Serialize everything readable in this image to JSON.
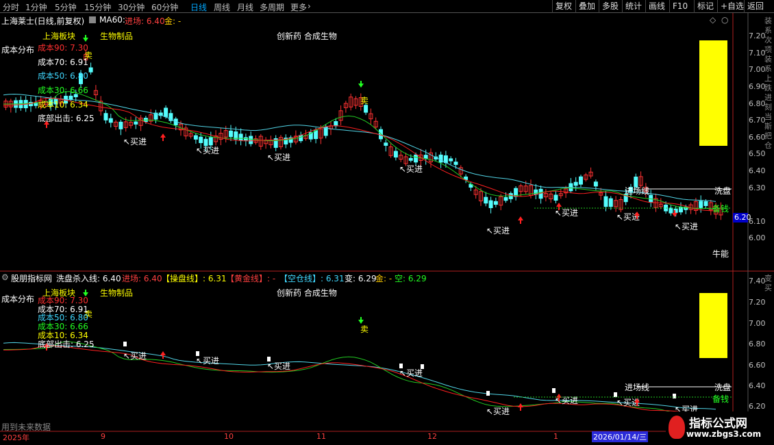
{
  "toolbar": {
    "periods": [
      "分时",
      "1分钟",
      "5分钟",
      "15分钟",
      "30分钟",
      "60分钟",
      "日线",
      "周线",
      "月线",
      "多周期",
      "更多"
    ],
    "more_arrow": "›",
    "buttons": [
      "复权",
      "叠加",
      "多股",
      "统计",
      "画线",
      "F10",
      "标记",
      "+自选",
      "返回"
    ]
  },
  "top_panel": {
    "title": "上海莱士(日线,前复权)",
    "ma_label": "MA60:",
    "jinchang_label": "进场: 6.40",
    "jin_label": "金: -",
    "cost_dist": "成本分布",
    "sector": "上海板块",
    "industry": "生物制品",
    "concepts": "创新药 合成生物",
    "cost90": "成本90: 7.30",
    "cost70": "成本70: 6.91",
    "cost50": "成本50: 6.80",
    "cost30": "成本30: 6.66",
    "cost10": "成本10: 6.34",
    "bottom_out": "底部出击: 6.25",
    "y_ticks": [
      "7.20",
      "7.10",
      "7.00",
      "6.90",
      "6.80",
      "6.70",
      "6.60",
      "6.50",
      "6.40",
      "6.30",
      "6.20",
      "6.10",
      "6.00"
    ],
    "price_tag": "6.20",
    "xipan_label": "洗盘",
    "jinchangxian_label": "进场线",
    "beiqian_label": "备钱",
    "niuneng_label": "牛能",
    "right_strip": "装系次项装系上跌进刻当斯把仓",
    "right_strip_small": "上跌\n刻当\n把仓"
  },
  "bottom_panel": {
    "title": "股朋指标网",
    "line1": "洗盘杀入线: 6.40",
    "line2": "进场: 6.40",
    "line3": "【操盘线】: 6.31",
    "line4": "【黄金线】: -",
    "line5": "【空仓线】: 6.31",
    "line6": "变: 6.29",
    "line7": "金: -",
    "line8": "空: 6.29",
    "cost_dist": "成本分布",
    "sector": "上海板块",
    "industry": "生物制品",
    "concepts": "创新药 合成生物",
    "cost90": "成本90: 7.30",
    "cost70": "成本70: 6.91",
    "cost50": "成本50: 6.80",
    "cost30": "成本30: 6.66",
    "cost10": "成本10: 6.34",
    "bottom_out": "底部出击: 6.25",
    "y_ticks": [
      "7.40",
      "7.20",
      "7.00",
      "6.80",
      "6.60",
      "6.40",
      "6.20"
    ],
    "xipan_label": "洗盘",
    "jinchangxian_label": "进场线",
    "beiqian_label": "备钱",
    "future_note": "用到未来数据",
    "right_strip": "变买"
  },
  "signals": {
    "sell": "卖",
    "buy": "买进",
    "buy_arrow": "↖"
  },
  "x_axis": {
    "labels": [
      "2025年",
      "9",
      "10",
      "11",
      "12",
      "1"
    ],
    "cursor_date": "2026/01/14/三"
  },
  "watermark": {
    "title": "指标公式网",
    "url": "www.zbgs3.com"
  },
  "colors": {
    "up": "#ff3232",
    "down": "#54fcfc",
    "ma_white": "#ffffff",
    "cyan_line": "#52d6e8",
    "green_line": "#22cc22",
    "red_line": "#ff2020",
    "yellow": "#ffff00",
    "blue_tag": "#0000c8"
  }
}
